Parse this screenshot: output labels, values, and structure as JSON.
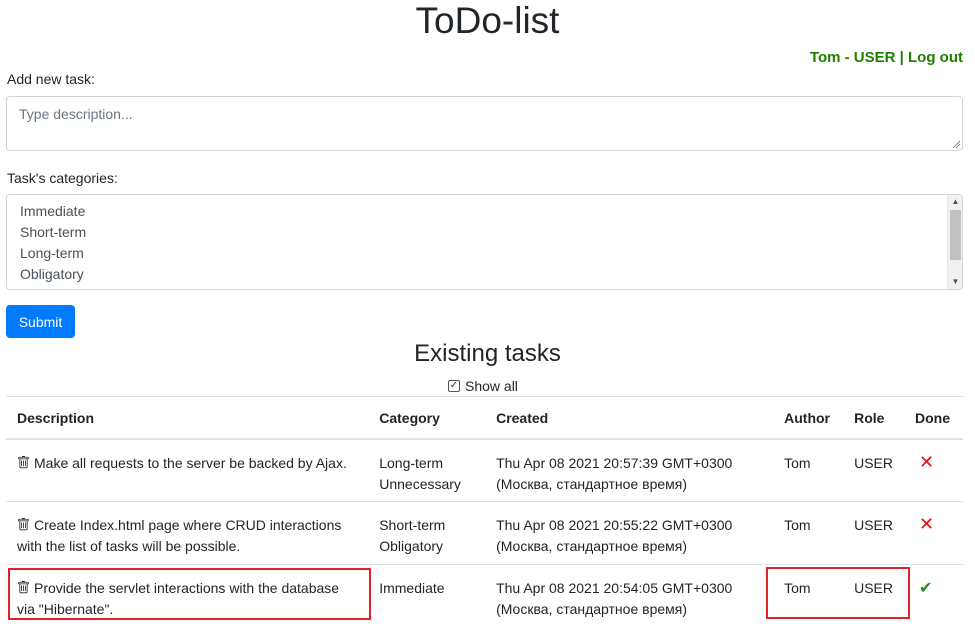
{
  "header": {
    "title": "ToDo-list"
  },
  "user": {
    "name_role": "Tom - USER",
    "separator": "|",
    "logout_label": "Log out"
  },
  "form": {
    "add_label": "Add new task:",
    "description_placeholder": "Type description...",
    "categories_label": "Task's categories:",
    "categories": [
      "Immediate",
      "Short-term",
      "Long-term",
      "Obligatory"
    ],
    "submit_label": "Submit"
  },
  "tasks_section": {
    "title": "Existing tasks",
    "show_all_label": "Show all",
    "show_all_checked": true,
    "columns": [
      "Description",
      "Category",
      "Created",
      "Author",
      "Role",
      "Done"
    ],
    "rows": [
      {
        "description": "Make all requests to the server be backed by Ajax.",
        "category_1": "Long-term",
        "category_2": "Unnecessary",
        "created_1": "Thu Apr 08 2021 20:57:39 GMT+0300",
        "created_2": "(Москва, стандартное время)",
        "author": "Tom",
        "role": "USER",
        "done": "✕"
      },
      {
        "description": "Create Index.html page where CRUD interactions with the list of tasks will be possible.",
        "category_1": "Short-term",
        "category_2": "Obligatory",
        "created_1": "Thu Apr 08 2021 20:55:22 GMT+0300",
        "created_2": "(Москва, стандартное время)",
        "author": "Tom",
        "role": "USER",
        "done": "✕"
      },
      {
        "description": "Provide the servlet interactions with the database via \"Hibernate\".",
        "category_1": "Immediate",
        "category_2": "",
        "created_1": "Thu Apr 08 2021 20:54:05 GMT+0300",
        "created_2": "(Москва, стандартное время)",
        "author": "Tom",
        "role": "USER",
        "done": "✔"
      }
    ]
  },
  "colors": {
    "primary": "#007bff",
    "user_link": "#1e7e00",
    "not_done": "#e0151a",
    "done": "#1e8a1e",
    "highlight": "#e0202a"
  },
  "icons": {
    "delete": "trash-icon",
    "not_done": "cross-icon",
    "done": "check-icon"
  }
}
